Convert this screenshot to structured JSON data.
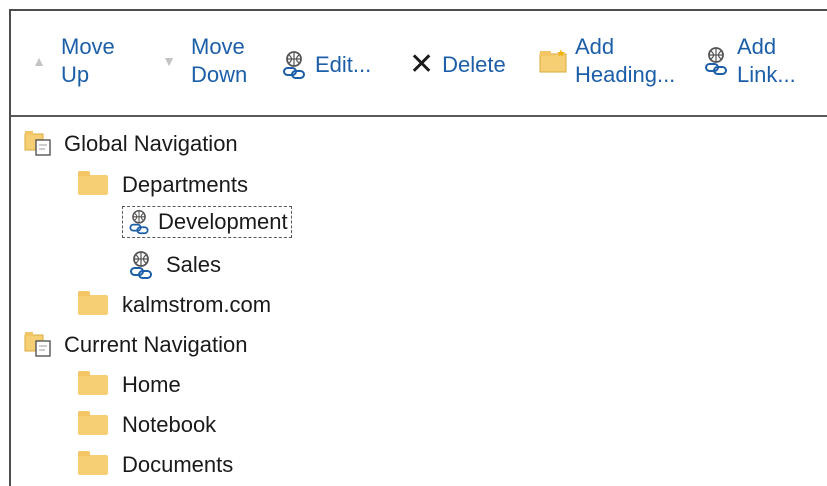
{
  "toolbar": {
    "move_up": [
      "Move",
      "Up"
    ],
    "move_down": [
      "Move",
      "Down"
    ],
    "edit": "Edit...",
    "delete": "Delete",
    "add_heading": [
      "Add",
      "Heading..."
    ],
    "add_link": [
      "Add",
      "Link..."
    ]
  },
  "tree": {
    "global_nav": "Global Navigation",
    "departments": "Departments",
    "development": "Development",
    "sales": "Sales",
    "kalmstrom": "kalmstrom.com",
    "current_nav": "Current Navigation",
    "home": "Home",
    "notebook": "Notebook",
    "documents": "Documents"
  },
  "colors": {
    "link_text": "#1c5fa8",
    "folder": "#f6cf75",
    "border": "#4d4d4d"
  }
}
